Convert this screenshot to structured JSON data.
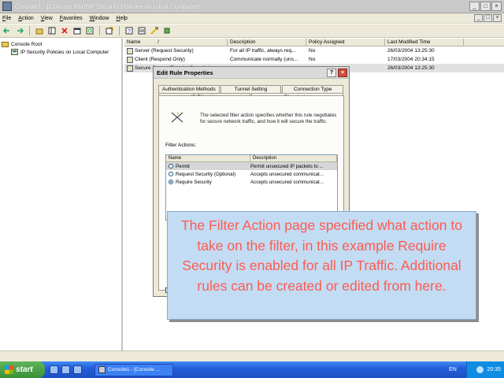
{
  "window": {
    "title": "Console1 - [Console Root\\IP Security Policies on Local Computer]",
    "buttons": [
      "_",
      "□",
      "×"
    ]
  },
  "menu": {
    "items": [
      "File",
      "Action",
      "View",
      "Favorites",
      "Window",
      "Help"
    ],
    "child_buttons": [
      "_",
      "□",
      "×"
    ]
  },
  "toolbar": {
    "icons": [
      "back-icon",
      "forward-icon",
      "up-folder-icon",
      "show-tree-icon",
      "delete-icon",
      "properties-icon",
      "refresh-icon",
      "export-icon",
      "help-icon",
      "add-filter-icon",
      "manage-filters-icon",
      "assign-icon"
    ]
  },
  "tree": {
    "root": "Console Root",
    "child": "IP Security Policies on Local Computer"
  },
  "list": {
    "columns": [
      "Name",
      "Description",
      "Policy Assigned",
      "Last Modified Time"
    ],
    "sort_indicator": "/",
    "rows": [
      {
        "name": "Server (Request Security)",
        "desc": "For all IP traffic, always req...",
        "assigned": "No",
        "time": "26/03/2004 13:25:30"
      },
      {
        "name": "Client (Respond Only)",
        "desc": "Communicate normally (uns...",
        "assigned": "No",
        "time": "17/03/2004 20:34:15"
      },
      {
        "name": "Secure Server (Require Security)",
        "desc": "",
        "assigned": "",
        "time": "26/03/2004 13:25:30"
      }
    ]
  },
  "dialog": {
    "title": "Edit Rule Properties",
    "help_btn": "?",
    "close_btn": "×",
    "tabs_back": [
      "Authentication Methods",
      "Tunnel Setting",
      "Connection Type"
    ],
    "tabs_front": [
      "IP Filter List",
      "Filter Action"
    ],
    "description": "The selected filter action specifies whether this rule negotiates for secure network traffic, and how it will secure the traffic.",
    "filter_actions_label": "Filter Actions:",
    "list_columns": [
      "Name",
      "Description"
    ],
    "actions": [
      {
        "name": "Permit",
        "desc": "Permit unsecured IP packets to ...",
        "selected": false
      },
      {
        "name": "Request Security (Optional)",
        "desc": "Accepts unsecured communicat...",
        "selected": false
      },
      {
        "name": "Require Security",
        "desc": "Accepts unsecured communicat...",
        "selected": true
      }
    ]
  },
  "callout": {
    "text": "The Filter Action page specified what action to take on the filter, in this example Require Security is enabled for all IP Traffic. Additional rules can be created or edited from here."
  },
  "taskbar": {
    "start_label": "start",
    "task_label": "Console1 - [Console ...",
    "lang": "EN",
    "clock": "20:35"
  }
}
